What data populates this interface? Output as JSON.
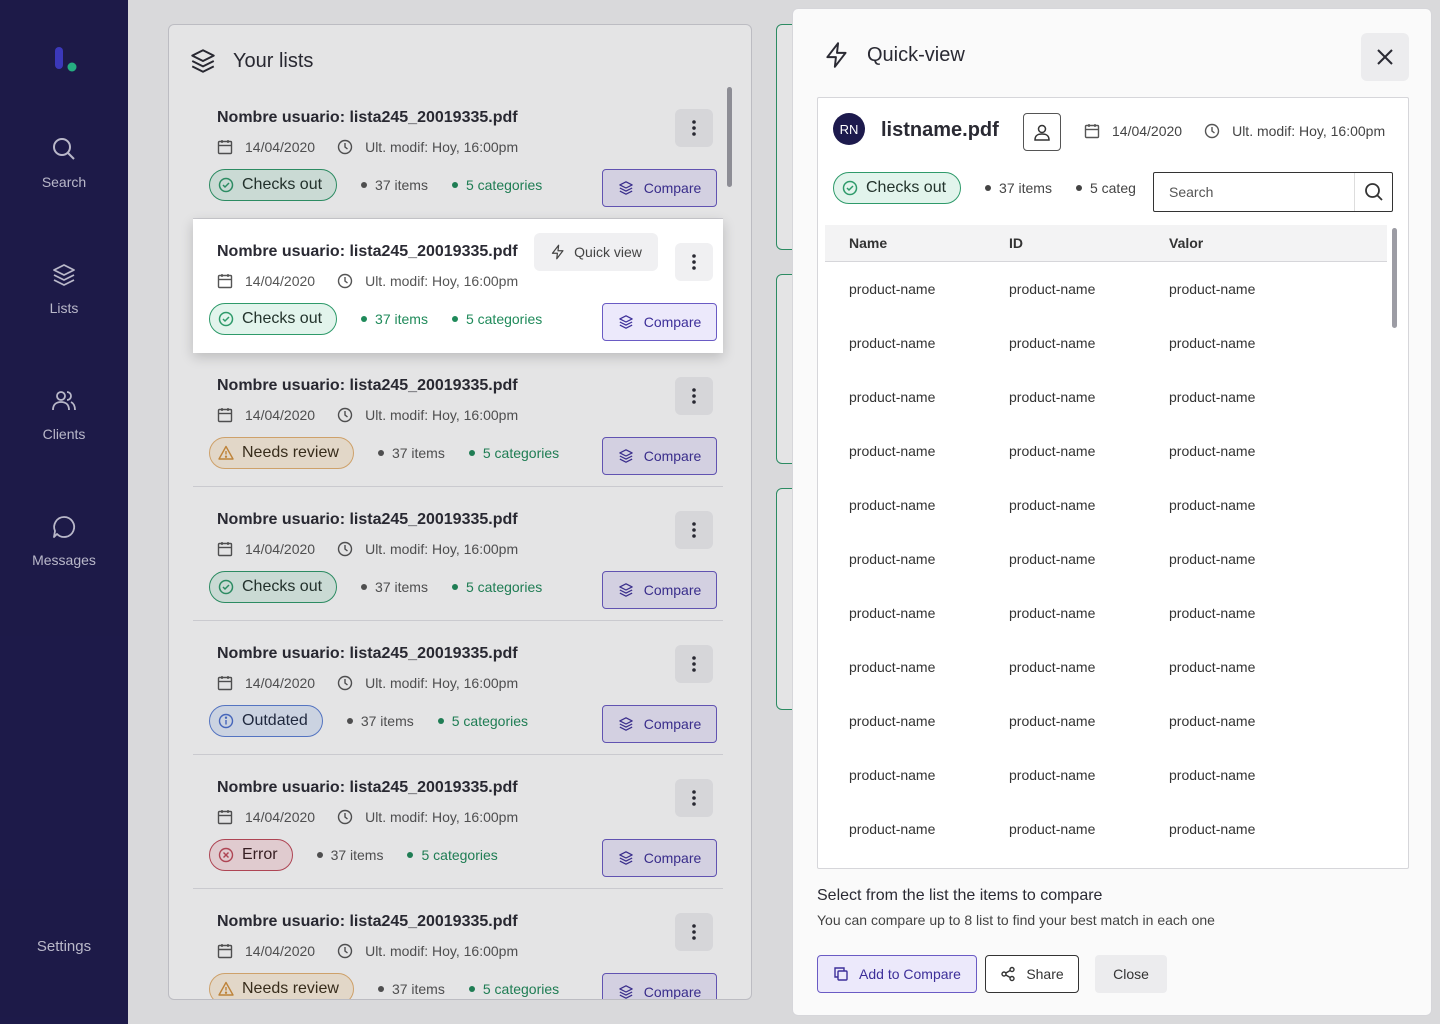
{
  "sidebar": {
    "items": [
      {
        "label": "Search",
        "icon": "search-icon"
      },
      {
        "label": "Lists",
        "icon": "layers-icon"
      },
      {
        "label": "Clients",
        "icon": "users-icon"
      },
      {
        "label": "Messages",
        "icon": "message-icon"
      }
    ],
    "settings_label": "Settings"
  },
  "lists_panel": {
    "title": "Your lists",
    "quick_view_label": "Quick view",
    "compare_label": "Compare",
    "cards": [
      {
        "title": "Nombre usuario: lista245_20019335.pdf",
        "date": "14/04/2020",
        "modified": "Ult. modif: Hoy, 16:00pm",
        "status": "Checks out",
        "status_type": "green",
        "items": "37 items",
        "categories": "5 categories",
        "items_green": false
      },
      {
        "title": "Nombre usuario: lista245_20019335.pdf",
        "date": "14/04/2020",
        "modified": "Ult. modif: Hoy, 16:00pm",
        "status": "Checks out",
        "status_type": "green",
        "items": "37 items",
        "categories": "5 categories",
        "items_green": true
      },
      {
        "title": "Nombre usuario: lista245_20019335.pdf",
        "date": "14/04/2020",
        "modified": "Ult. modif: Hoy, 16:00pm",
        "status": "Needs review",
        "status_type": "yellow",
        "items": "37 items",
        "categories": "5 categories",
        "items_green": false
      },
      {
        "title": "Nombre usuario: lista245_20019335.pdf",
        "date": "14/04/2020",
        "modified": "Ult. modif: Hoy, 16:00pm",
        "status": "Checks out",
        "status_type": "green",
        "items": "37 items",
        "categories": "5 categories",
        "items_green": false
      },
      {
        "title": "Nombre usuario: lista245_20019335.pdf",
        "date": "14/04/2020",
        "modified": "Ult. modif: Hoy, 16:00pm",
        "status": "Outdated",
        "status_type": "blue",
        "items": "37 items",
        "categories": "5 categories",
        "items_green": false
      },
      {
        "title": "Nombre usuario: lista245_20019335.pdf",
        "date": "14/04/2020",
        "modified": "Ult. modif: Hoy, 16:00pm",
        "status": "Error",
        "status_type": "red",
        "items": "37 items",
        "categories": "5 categories",
        "items_green": false
      },
      {
        "title": "Nombre usuario: lista245_20019335.pdf",
        "date": "14/04/2020",
        "modified": "Ult. modif: Hoy, 16:00pm",
        "status": "Needs review",
        "status_type": "yellow",
        "items": "37 items",
        "categories": "5 categories",
        "items_green": false
      }
    ]
  },
  "quick_view": {
    "title": "Quick-view",
    "avatar_initials": "RN",
    "file_name": "listname.pdf",
    "date": "14/04/2020",
    "modified": "Ult. modif: Hoy, 16:00pm",
    "status": "Checks out",
    "items": "37 items",
    "categories": "5 categ",
    "search": {
      "placeholder": "Search",
      "value": ""
    },
    "table": {
      "columns": [
        "Name",
        "ID",
        "Valor"
      ],
      "rows": [
        [
          "product-name",
          "product-name",
          "product-name"
        ],
        [
          "product-name",
          "product-name",
          "product-name"
        ],
        [
          "product-name",
          "product-name",
          "product-name"
        ],
        [
          "product-name",
          "product-name",
          "product-name"
        ],
        [
          "product-name",
          "product-name",
          "product-name"
        ],
        [
          "product-name",
          "product-name",
          "product-name"
        ],
        [
          "product-name",
          "product-name",
          "product-name"
        ],
        [
          "product-name",
          "product-name",
          "product-name"
        ],
        [
          "product-name",
          "product-name",
          "product-name"
        ],
        [
          "product-name",
          "product-name",
          "product-name"
        ],
        [
          "product-name",
          "product-name",
          "product-name"
        ]
      ]
    },
    "footer_title": "Select from the list the items to compare",
    "footer_subtitle": "You can compare up to 8 list to find your best match in each one",
    "add_label": "Add to Compare",
    "share_label": "Share",
    "close_label": "Close"
  },
  "colors": {
    "sidebar_bg": "#1d1a4d",
    "accent": "#6a5bc4",
    "success": "#2e9a6a",
    "warning": "#e6b373",
    "info": "#5c80d6",
    "danger": "#c24a5a"
  }
}
